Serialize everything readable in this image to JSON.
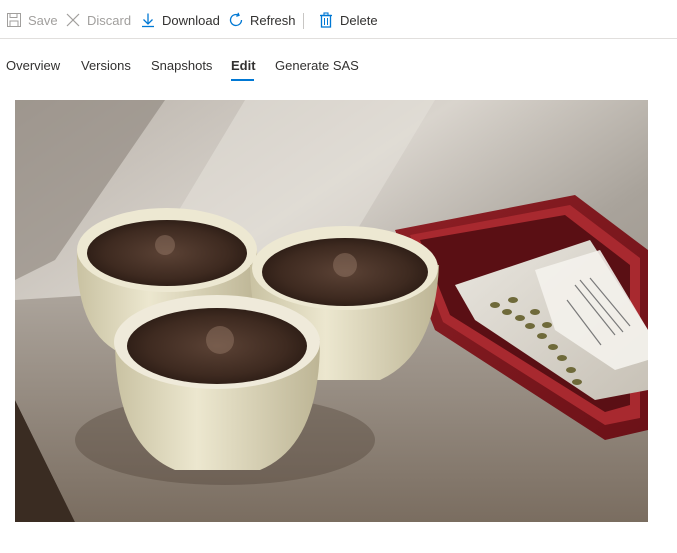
{
  "toolbar": {
    "save": {
      "label": "Save",
      "icon": "save-icon",
      "enabled": false
    },
    "discard": {
      "label": "Discard",
      "icon": "close-icon",
      "enabled": false
    },
    "download": {
      "label": "Download",
      "icon": "download-icon",
      "enabled": true
    },
    "refresh": {
      "label": "Refresh",
      "icon": "refresh-icon",
      "enabled": true
    },
    "delete": {
      "label": "Delete",
      "icon": "trash-icon",
      "enabled": true
    }
  },
  "tabs": [
    {
      "label": "Overview",
      "active": false
    },
    {
      "label": "Versions",
      "active": false
    },
    {
      "label": "Snapshots",
      "active": false
    },
    {
      "label": "Edit",
      "active": true
    },
    {
      "label": "Generate SAS",
      "active": false
    }
  ],
  "colors": {
    "accent": "#0078d4",
    "text": "#323130",
    "disabled_text": "#a19f9d"
  },
  "preview": {
    "subject": "three cupping bowls of ground coffee and a bag of green coffee beans in a red tray"
  }
}
